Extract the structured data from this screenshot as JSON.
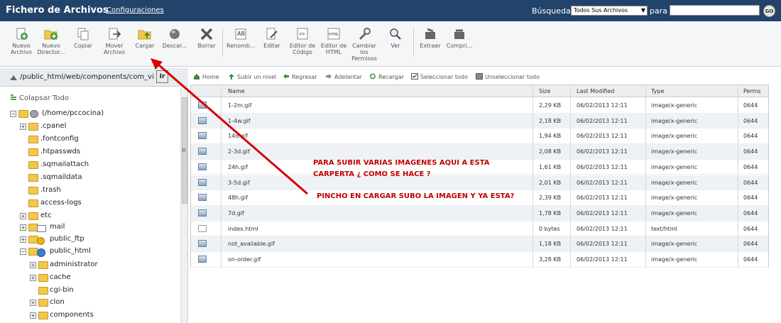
{
  "header": {
    "title": "Fichero de Archivos",
    "config_link": "Configuraciones",
    "search_label": "Búsqueda",
    "search_scope": "Todos Sus Archivos",
    "para_label": "para",
    "search_value": "",
    "go_label": "GO"
  },
  "toolbar": {
    "items": [
      {
        "label": "Nuevo Archivo",
        "icon": "new-file-icon"
      },
      {
        "label": "Nuevo Director...",
        "icon": "new-folder-icon"
      },
      {
        "label": "Copiar",
        "icon": "copy-icon"
      },
      {
        "label": "Mover Archivo",
        "icon": "move-icon"
      },
      {
        "label": "Cargar",
        "icon": "upload-icon"
      },
      {
        "label": "Descar...",
        "icon": "download-icon"
      },
      {
        "label": "Borrar",
        "icon": "delete-icon"
      },
      {
        "label": "Renomb...",
        "icon": "rename-icon"
      },
      {
        "label": "Editar",
        "icon": "edit-icon"
      },
      {
        "label": "Editor de Código",
        "icon": "code-editor-icon"
      },
      {
        "label": "Editor de HTML",
        "icon": "html-editor-icon"
      },
      {
        "label": "Cambiar los Permisos",
        "icon": "permissions-icon"
      },
      {
        "label": "Ver",
        "icon": "view-icon"
      },
      {
        "label": "Extraer",
        "icon": "extract-icon"
      },
      {
        "label": "Compri...",
        "icon": "compress-icon"
      }
    ]
  },
  "path": {
    "value": "/public_html/web/components/com_virtu",
    "go_label": "Ir"
  },
  "actions": {
    "home": "Home",
    "up": "Subir un nivel",
    "back": "Regresar",
    "forward": "Adelantar",
    "reload": "Recargar",
    "select_all": "Seleccionar todo",
    "deselect_all": "Unseleccionar todo"
  },
  "tree": {
    "collapse_all": "Colapsar Todo",
    "root": "(/home/pccocina)",
    "items": [
      ".cpanel",
      ".fontconfig",
      ".htpasswds",
      ".sqmailattach",
      ".sqmaildata",
      ".trash",
      "access-logs",
      "etc",
      "mail",
      "public_ftp",
      "public_html",
      "administrator",
      "cache",
      "cgi-bin",
      "clon",
      "components"
    ]
  },
  "table": {
    "columns": [
      "Name",
      "Size",
      "Last Modified",
      "Type",
      "Perms"
    ],
    "rows": [
      {
        "name": "1-2m.gif",
        "size": "2,29 KB",
        "modified": "06/02/2013 12:11",
        "type": "image/x-generic",
        "perms": "0644"
      },
      {
        "name": "1-4w.gif",
        "size": "2,18 KB",
        "modified": "06/02/2013 12:11",
        "type": "image/x-generic",
        "perms": "0644"
      },
      {
        "name": "14d.gif",
        "size": "1,94 KB",
        "modified": "06/02/2013 12:11",
        "type": "image/x-generic",
        "perms": "0644"
      },
      {
        "name": "2-3d.gif",
        "size": "2,08 KB",
        "modified": "06/02/2013 12:11",
        "type": "image/x-generic",
        "perms": "0644"
      },
      {
        "name": "24h.gif",
        "size": "1,61 KB",
        "modified": "06/02/2013 12:11",
        "type": "image/x-generic",
        "perms": "0644"
      },
      {
        "name": "3-5d.gif",
        "size": "2,01 KB",
        "modified": "06/02/2013 12:11",
        "type": "image/x-generic",
        "perms": "0644"
      },
      {
        "name": "48h.gif",
        "size": "2,39 KB",
        "modified": "06/02/2013 12:11",
        "type": "image/x-generic",
        "perms": "0644"
      },
      {
        "name": "7d.gif",
        "size": "1,78 KB",
        "modified": "06/02/2013 12:11",
        "type": "image/x-generic",
        "perms": "0644"
      },
      {
        "name": "index.html",
        "size": "0 bytes",
        "modified": "06/02/2013 12:11",
        "type": "text/html",
        "perms": "0644"
      },
      {
        "name": "not_available.gif",
        "size": "1,18 KB",
        "modified": "06/02/2013 12:11",
        "type": "image/x-generic",
        "perms": "0644"
      },
      {
        "name": "on-order.gif",
        "size": "3,28 KB",
        "modified": "06/02/2013 12:11",
        "type": "image/x-generic",
        "perms": "0644"
      }
    ]
  },
  "annotations": {
    "line1": "PARA SUBIR VARIAS IMAGENES AQUI A ESTA",
    "line2": "CARPERTA ¿ COMO SE HACE ?",
    "line3": "PINCHO EN CARGAR SUBO LA IMAGEN Y YA ESTA?",
    "arrow_color": "#d40000"
  },
  "colors": {
    "header_bg": "#22436a",
    "annotation": "#c00000"
  }
}
